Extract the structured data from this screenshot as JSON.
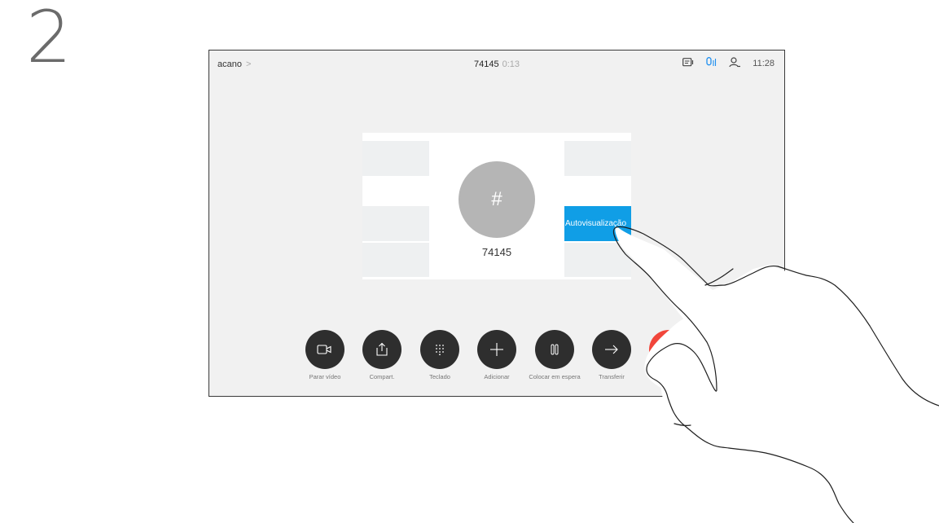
{
  "step": {
    "number": "2"
  },
  "statusbar": {
    "breadcrumb": "acano",
    "breadcrumb_chevron": ">",
    "call_number": "74145",
    "call_duration": "0:13",
    "time": "11:28",
    "icons": [
      "display-icon",
      "microphone-icon",
      "contacts-icon"
    ]
  },
  "call": {
    "avatar_symbol": "#",
    "participant": "74145",
    "selfview_label": "Autovisualização"
  },
  "controls": [
    {
      "label": "Parar vídeo",
      "icon": "video-camera-icon"
    },
    {
      "label": "Compart.",
      "icon": "share-icon"
    },
    {
      "label": "Teclado",
      "icon": "keypad-icon"
    },
    {
      "label": "Adicionar",
      "icon": "plus-icon"
    },
    {
      "label": "Colocar em espera",
      "icon": "pause-icon"
    },
    {
      "label": "Transferir",
      "icon": "arrow-right-icon"
    },
    {
      "label": "",
      "icon": "close-icon"
    }
  ],
  "colors": {
    "selfview": "#109ee6",
    "end_call": "#f1463b",
    "button": "#2e2e2e",
    "mic_active": "#1e8ff0"
  }
}
